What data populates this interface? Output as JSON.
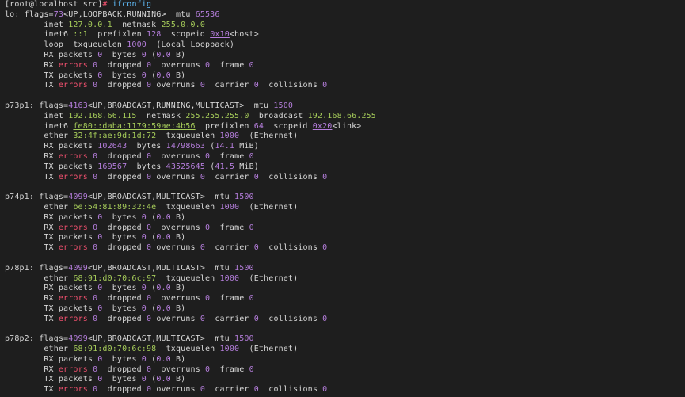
{
  "prompt": {
    "text": "[root@localhost src]",
    "hash": "#",
    "command": "ifconfig"
  },
  "colors": {
    "background": "#1e1e1e",
    "text": "#d6d6d6",
    "number": "#b57edc",
    "address": "#a6cc5a",
    "error": "#f0506e",
    "command": "#61c0ff"
  },
  "interfaces": [
    {
      "lines": [
        [
          [
            "lo: flags=",
            "w"
          ],
          [
            "73",
            "p"
          ],
          [
            "<UP,LOOPBACK,RUNNING>  mtu ",
            "w"
          ],
          [
            "65536",
            "p"
          ]
        ],
        [
          [
            "        inet ",
            "w"
          ],
          [
            "127.0.0.1",
            "g"
          ],
          [
            "  netmask ",
            "w"
          ],
          [
            "255.0.0.0",
            "g"
          ]
        ],
        [
          [
            "        inet6 ",
            "w"
          ],
          [
            "::1",
            "g"
          ],
          [
            "  prefixlen ",
            "w"
          ],
          [
            "128",
            "p"
          ],
          [
            "  scopeid ",
            "w"
          ],
          [
            "0x10",
            "pu"
          ],
          [
            "<host>",
            "w"
          ]
        ],
        [
          [
            "        loop  txqueuelen ",
            "w"
          ],
          [
            "1000",
            "p"
          ],
          [
            "  (Local Loopback)",
            "w"
          ]
        ],
        [
          [
            "        RX packets ",
            "w"
          ],
          [
            "0",
            "p"
          ],
          [
            "  bytes ",
            "w"
          ],
          [
            "0",
            "p"
          ],
          [
            " (",
            "w"
          ],
          [
            "0.0",
            "p"
          ],
          [
            " B)",
            "w"
          ]
        ],
        [
          [
            "        RX ",
            "w"
          ],
          [
            "errors",
            "r"
          ],
          [
            " ",
            "w"
          ],
          [
            "0",
            "p"
          ],
          [
            "  dropped ",
            "w"
          ],
          [
            "0",
            "p"
          ],
          [
            "  overruns ",
            "w"
          ],
          [
            "0",
            "p"
          ],
          [
            "  frame ",
            "w"
          ],
          [
            "0",
            "p"
          ]
        ],
        [
          [
            "        TX packets ",
            "w"
          ],
          [
            "0",
            "p"
          ],
          [
            "  bytes ",
            "w"
          ],
          [
            "0",
            "p"
          ],
          [
            " (",
            "w"
          ],
          [
            "0.0",
            "p"
          ],
          [
            " B)",
            "w"
          ]
        ],
        [
          [
            "        TX ",
            "w"
          ],
          [
            "errors",
            "r"
          ],
          [
            " ",
            "w"
          ],
          [
            "0",
            "p"
          ],
          [
            "  dropped ",
            "w"
          ],
          [
            "0",
            "p"
          ],
          [
            " overruns ",
            "w"
          ],
          [
            "0",
            "p"
          ],
          [
            "  carrier ",
            "w"
          ],
          [
            "0",
            "p"
          ],
          [
            "  collisions ",
            "w"
          ],
          [
            "0",
            "p"
          ]
        ]
      ]
    },
    {
      "lines": [
        [
          [
            "p73p1: flags=",
            "w"
          ],
          [
            "4163",
            "p"
          ],
          [
            "<UP,BROADCAST,RUNNING,MULTICAST>  mtu ",
            "w"
          ],
          [
            "1500",
            "p"
          ]
        ],
        [
          [
            "        inet ",
            "w"
          ],
          [
            "192.168.66.115",
            "g"
          ],
          [
            "  netmask ",
            "w"
          ],
          [
            "255.255.255.0",
            "g"
          ],
          [
            "  broadcast ",
            "w"
          ],
          [
            "192.168.66.255",
            "g"
          ]
        ],
        [
          [
            "        inet6 ",
            "w"
          ],
          [
            "fe80::daba:1179:59ae:4b56",
            "gu"
          ],
          [
            "  prefixlen ",
            "w"
          ],
          [
            "64",
            "p"
          ],
          [
            "  scopeid ",
            "w"
          ],
          [
            "0x20",
            "pu"
          ],
          [
            "<link>",
            "w"
          ]
        ],
        [
          [
            "        ether ",
            "w"
          ],
          [
            "32:4f:ae:9d:1d:72",
            "g"
          ],
          [
            "  txqueuelen ",
            "w"
          ],
          [
            "1000",
            "p"
          ],
          [
            "  (Ethernet)",
            "w"
          ]
        ],
        [
          [
            "        RX packets ",
            "w"
          ],
          [
            "102643",
            "p"
          ],
          [
            "  bytes ",
            "w"
          ],
          [
            "14798663",
            "p"
          ],
          [
            " (",
            "w"
          ],
          [
            "14.1",
            "p"
          ],
          [
            " MiB)",
            "w"
          ]
        ],
        [
          [
            "        RX ",
            "w"
          ],
          [
            "errors",
            "r"
          ],
          [
            " ",
            "w"
          ],
          [
            "0",
            "p"
          ],
          [
            "  dropped ",
            "w"
          ],
          [
            "0",
            "p"
          ],
          [
            "  overruns ",
            "w"
          ],
          [
            "0",
            "p"
          ],
          [
            "  frame ",
            "w"
          ],
          [
            "0",
            "p"
          ]
        ],
        [
          [
            "        TX packets ",
            "w"
          ],
          [
            "169567",
            "p"
          ],
          [
            "  bytes ",
            "w"
          ],
          [
            "43525645",
            "p"
          ],
          [
            " (",
            "w"
          ],
          [
            "41.5",
            "p"
          ],
          [
            " MiB)",
            "w"
          ]
        ],
        [
          [
            "        TX ",
            "w"
          ],
          [
            "errors",
            "r"
          ],
          [
            " ",
            "w"
          ],
          [
            "0",
            "p"
          ],
          [
            "  dropped ",
            "w"
          ],
          [
            "0",
            "p"
          ],
          [
            " overruns ",
            "w"
          ],
          [
            "0",
            "p"
          ],
          [
            "  carrier ",
            "w"
          ],
          [
            "0",
            "p"
          ],
          [
            "  collisions ",
            "w"
          ],
          [
            "0",
            "p"
          ]
        ]
      ]
    },
    {
      "lines": [
        [
          [
            "p74p1: flags=",
            "w"
          ],
          [
            "4099",
            "p"
          ],
          [
            "<UP,BROADCAST,MULTICAST>  mtu ",
            "w"
          ],
          [
            "1500",
            "p"
          ]
        ],
        [
          [
            "        ether ",
            "w"
          ],
          [
            "be:54:81:89:32:4e",
            "g"
          ],
          [
            "  txqueuelen ",
            "w"
          ],
          [
            "1000",
            "p"
          ],
          [
            "  (Ethernet)",
            "w"
          ]
        ],
        [
          [
            "        RX packets ",
            "w"
          ],
          [
            "0",
            "p"
          ],
          [
            "  bytes ",
            "w"
          ],
          [
            "0",
            "p"
          ],
          [
            " (",
            "w"
          ],
          [
            "0.0",
            "p"
          ],
          [
            " B)",
            "w"
          ]
        ],
        [
          [
            "        RX ",
            "w"
          ],
          [
            "errors",
            "r"
          ],
          [
            " ",
            "w"
          ],
          [
            "0",
            "p"
          ],
          [
            "  dropped ",
            "w"
          ],
          [
            "0",
            "p"
          ],
          [
            "  overruns ",
            "w"
          ],
          [
            "0",
            "p"
          ],
          [
            "  frame ",
            "w"
          ],
          [
            "0",
            "p"
          ]
        ],
        [
          [
            "        TX packets ",
            "w"
          ],
          [
            "0",
            "p"
          ],
          [
            "  bytes ",
            "w"
          ],
          [
            "0",
            "p"
          ],
          [
            " (",
            "w"
          ],
          [
            "0.0",
            "p"
          ],
          [
            " B)",
            "w"
          ]
        ],
        [
          [
            "        TX ",
            "w"
          ],
          [
            "errors",
            "r"
          ],
          [
            " ",
            "w"
          ],
          [
            "0",
            "p"
          ],
          [
            "  dropped ",
            "w"
          ],
          [
            "0",
            "p"
          ],
          [
            " overruns ",
            "w"
          ],
          [
            "0",
            "p"
          ],
          [
            "  carrier ",
            "w"
          ],
          [
            "0",
            "p"
          ],
          [
            "  collisions ",
            "w"
          ],
          [
            "0",
            "p"
          ]
        ]
      ]
    },
    {
      "lines": [
        [
          [
            "p78p1: flags=",
            "w"
          ],
          [
            "4099",
            "p"
          ],
          [
            "<UP,BROADCAST,MULTICAST>  mtu ",
            "w"
          ],
          [
            "1500",
            "p"
          ]
        ],
        [
          [
            "        ether ",
            "w"
          ],
          [
            "68:91:d0:70:6c:97",
            "g"
          ],
          [
            "  txqueuelen ",
            "w"
          ],
          [
            "1000",
            "p"
          ],
          [
            "  (Ethernet)",
            "w"
          ]
        ],
        [
          [
            "        RX packets ",
            "w"
          ],
          [
            "0",
            "p"
          ],
          [
            "  bytes ",
            "w"
          ],
          [
            "0",
            "p"
          ],
          [
            " (",
            "w"
          ],
          [
            "0.0",
            "p"
          ],
          [
            " B)",
            "w"
          ]
        ],
        [
          [
            "        RX ",
            "w"
          ],
          [
            "errors",
            "r"
          ],
          [
            " ",
            "w"
          ],
          [
            "0",
            "p"
          ],
          [
            "  dropped ",
            "w"
          ],
          [
            "0",
            "p"
          ],
          [
            "  overruns ",
            "w"
          ],
          [
            "0",
            "p"
          ],
          [
            "  frame ",
            "w"
          ],
          [
            "0",
            "p"
          ]
        ],
        [
          [
            "        TX packets ",
            "w"
          ],
          [
            "0",
            "p"
          ],
          [
            "  bytes ",
            "w"
          ],
          [
            "0",
            "p"
          ],
          [
            " (",
            "w"
          ],
          [
            "0.0",
            "p"
          ],
          [
            " B)",
            "w"
          ]
        ],
        [
          [
            "        TX ",
            "w"
          ],
          [
            "errors",
            "r"
          ],
          [
            " ",
            "w"
          ],
          [
            "0",
            "p"
          ],
          [
            "  dropped ",
            "w"
          ],
          [
            "0",
            "p"
          ],
          [
            " overruns ",
            "w"
          ],
          [
            "0",
            "p"
          ],
          [
            "  carrier ",
            "w"
          ],
          [
            "0",
            "p"
          ],
          [
            "  collisions ",
            "w"
          ],
          [
            "0",
            "p"
          ]
        ]
      ]
    },
    {
      "lines": [
        [
          [
            "p78p2: flags=",
            "w"
          ],
          [
            "4099",
            "p"
          ],
          [
            "<UP,BROADCAST,MULTICAST>  mtu ",
            "w"
          ],
          [
            "1500",
            "p"
          ]
        ],
        [
          [
            "        ether ",
            "w"
          ],
          [
            "68:91:d0:70:6c:98",
            "g"
          ],
          [
            "  txqueuelen ",
            "w"
          ],
          [
            "1000",
            "p"
          ],
          [
            "  (Ethernet)",
            "w"
          ]
        ],
        [
          [
            "        RX packets ",
            "w"
          ],
          [
            "0",
            "p"
          ],
          [
            "  bytes ",
            "w"
          ],
          [
            "0",
            "p"
          ],
          [
            " (",
            "w"
          ],
          [
            "0.0",
            "p"
          ],
          [
            " B)",
            "w"
          ]
        ],
        [
          [
            "        RX ",
            "w"
          ],
          [
            "errors",
            "r"
          ],
          [
            " ",
            "w"
          ],
          [
            "0",
            "p"
          ],
          [
            "  dropped ",
            "w"
          ],
          [
            "0",
            "p"
          ],
          [
            "  overruns ",
            "w"
          ],
          [
            "0",
            "p"
          ],
          [
            "  frame ",
            "w"
          ],
          [
            "0",
            "p"
          ]
        ],
        [
          [
            "        TX packets ",
            "w"
          ],
          [
            "0",
            "p"
          ],
          [
            "  bytes ",
            "w"
          ],
          [
            "0",
            "p"
          ],
          [
            " (",
            "w"
          ],
          [
            "0.0",
            "p"
          ],
          [
            " B)",
            "w"
          ]
        ],
        [
          [
            "        TX ",
            "w"
          ],
          [
            "errors",
            "r"
          ],
          [
            " ",
            "w"
          ],
          [
            "0",
            "p"
          ],
          [
            "  dropped ",
            "w"
          ],
          [
            "0",
            "p"
          ],
          [
            " overruns ",
            "w"
          ],
          [
            "0",
            "p"
          ],
          [
            "  carrier ",
            "w"
          ],
          [
            "0",
            "p"
          ],
          [
            "  collisions ",
            "w"
          ],
          [
            "0",
            "p"
          ]
        ]
      ]
    }
  ]
}
